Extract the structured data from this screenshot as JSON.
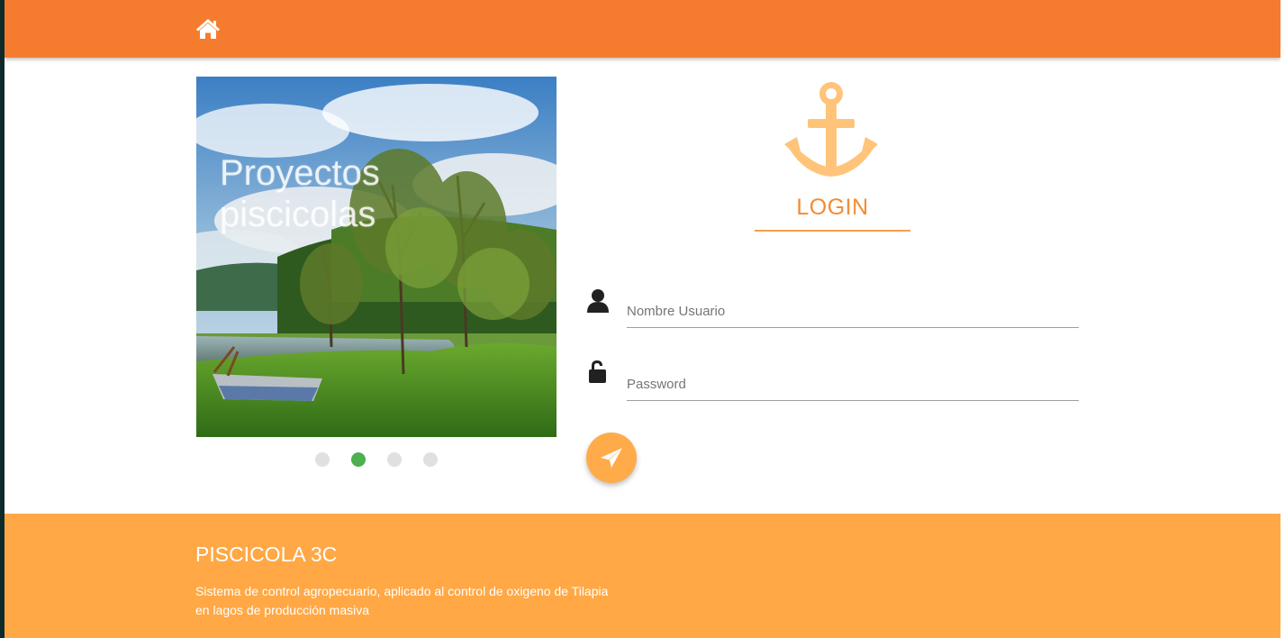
{
  "header": {
    "home_icon": "home-icon",
    "color": "#f57c2f"
  },
  "carousel": {
    "caption": "Proyectos piscicolas",
    "indicators": [
      {
        "active": false
      },
      {
        "active": true
      },
      {
        "active": false
      },
      {
        "active": false
      }
    ],
    "active_color": "#4caf50"
  },
  "login": {
    "icon": "anchor-icon",
    "title": "LOGIN",
    "username": {
      "icon": "user-icon",
      "placeholder": "Nombre Usuario",
      "value": ""
    },
    "password": {
      "icon": "unlock-icon",
      "placeholder": "Password",
      "value": ""
    },
    "submit_icon": "paper-plane-icon",
    "accent": "#f58b30"
  },
  "footer": {
    "title": "PISCICOLA 3C",
    "description": "Sistema de control agropecuario, aplicado al control de oxigeno de Tilapia en lagos de producción masiva",
    "color": "#ffa845"
  }
}
